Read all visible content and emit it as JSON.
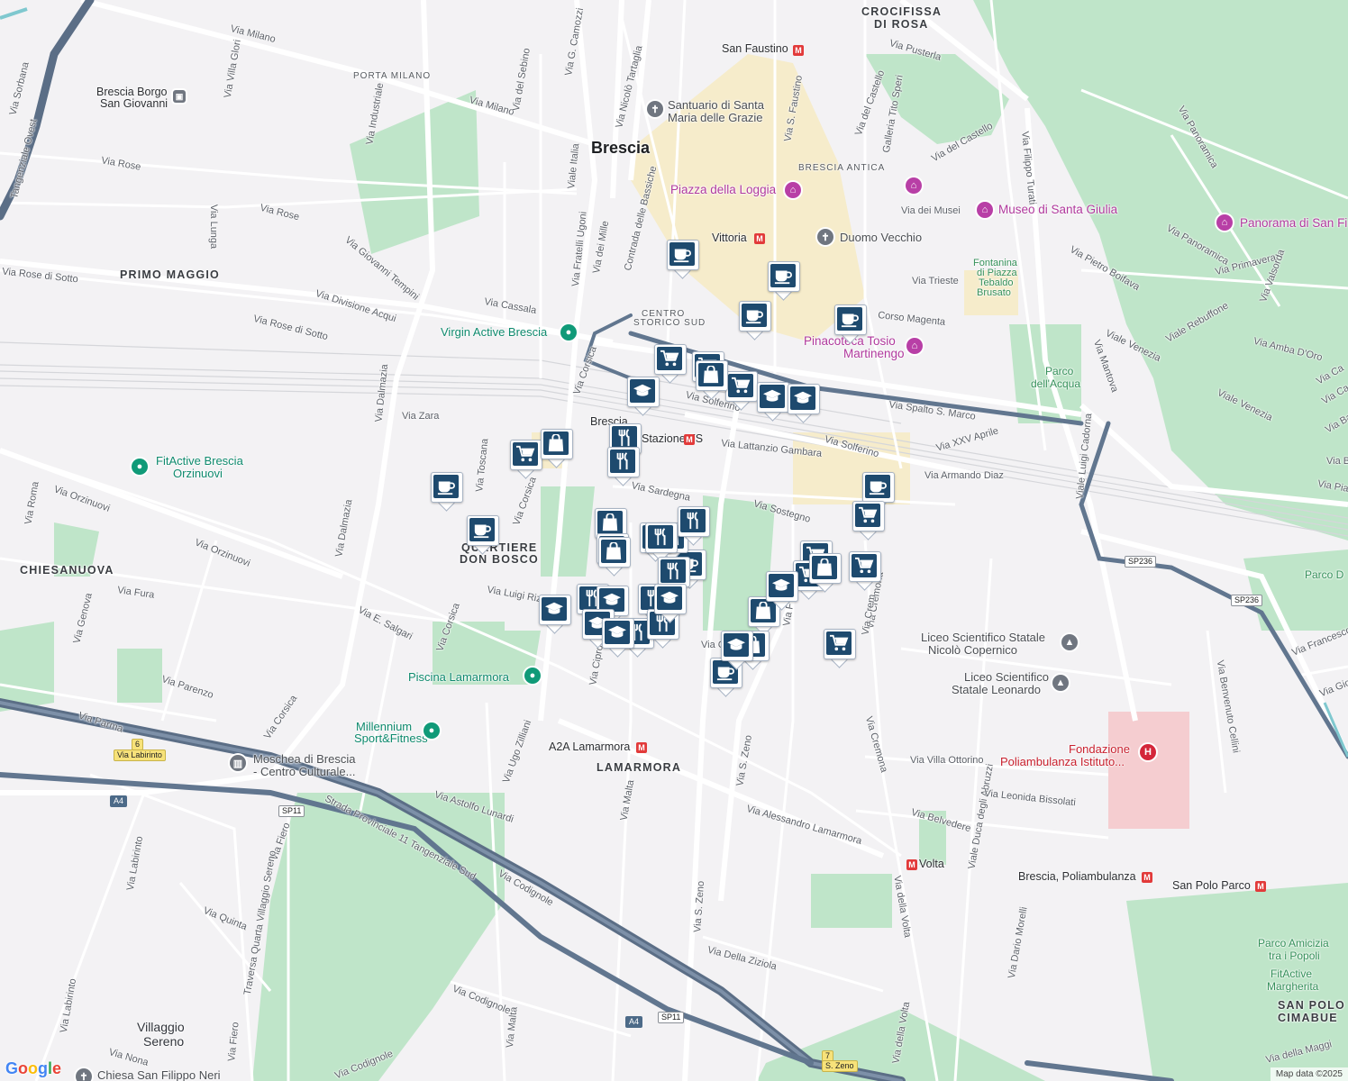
{
  "map": {
    "city": "Brescia",
    "districts": [
      {
        "name": "PRIMO MAGGIO"
      },
      {
        "name": "CHIESANUOVA"
      },
      {
        "name": "QUARTIERE"
      },
      {
        "name": "DON BOSCO"
      },
      {
        "name": "LAMARMORA"
      },
      {
        "name": "CROCIFISSA"
      },
      {
        "name": "DI ROSA"
      },
      {
        "name": "SAN POLO"
      },
      {
        "name": "CIMABUE"
      }
    ],
    "small_districts": [
      {
        "name": "PORTA MILANO"
      },
      {
        "name": "BRESCIA ANTICA"
      },
      {
        "name": "CENTRO"
      },
      {
        "name": "STORICO SUD"
      }
    ],
    "streets": [
      "Via Milano",
      "Via Milano",
      "Via Rose",
      "Via Rose",
      "Via Rose di Sotto",
      "Via Rose di Sotto",
      "Via Divisione Acqui",
      "Via Giovanni Tempini",
      "Via Cassala",
      "Via Lunga",
      "Via Industriale",
      "Via Villa Glori",
      "Via del Sebino",
      "Via G. Camozzi",
      "Via Nicolò Tartaglia",
      "Viale Italia",
      "Via Fratelli Ugoni",
      "Via dei Mille",
      "Contrada delle Bassiche",
      "Via Sorbana",
      "Tangenziale Ovest",
      "Via Dalmazia",
      "Via Dalmazia",
      "Via Zara",
      "Via Orzinuovi",
      "Via Orzinuovi",
      "Via Roma",
      "Via Genova",
      "Via Fura",
      "Via Toscana",
      "Via Corsica",
      "Via Corsica",
      "Via Corsica",
      "Via Corsica",
      "Via E. Salgari",
      "Via Parenzo",
      "Via Parma",
      "Via Luigi Rizzo",
      "Via Cipro",
      "Via Sardegna",
      "Via Solferino",
      "Via Solferino",
      "Via Lattanzio Gambara",
      "Via Sostegno",
      "Via Spalto S. Marco",
      "Via XXV Aprile",
      "Via Armando Diaz",
      "Via Cremona",
      "Via Cremona",
      "Via S. Zeno",
      "Via S. Zeno",
      "Via Malta",
      "Via Malta",
      "Via Ugo Zilliani",
      "Via Astolfo Lunardi",
      "Via Alessandro Lamarmora",
      "Via della Volta",
      "Via della Volta",
      "Via Codignole",
      "Via Codignole",
      "Via Codignole",
      "Via Della Ziziola",
      "Viale Duca degli Abruzzi",
      "Via Dario Morelli",
      "Via Villa Ottorino",
      "Via Leonida Bissolati",
      "Via Belvedere",
      "Via Labirinto",
      "Via Labirinto",
      "Via Fiero",
      "Via Fiero",
      "Via Quinta",
      "Traversa Quarta Villaggio Sereno",
      "Via Nona",
      "Strada Provinciale 11 Tangenziale Sud",
      "Via Pusterla",
      "Via del Castello",
      "Via del Castello",
      "Galleria Tito Speri",
      "Via S. Faustino",
      "Via dei Musei",
      "Via Trieste",
      "Corso Magenta",
      "Via Filippo Turati",
      "Via Pietro Boifava",
      "Viale Venezia",
      "Viale Venezia",
      "Viale Rebuffone",
      "Via Amba D'Oro",
      "Via Panoramica",
      "Via Panoramica",
      "Via Primavera",
      "Via Valsorda",
      "Viale Luigi Cadorna",
      "Via Mantova",
      "Via Francesco",
      "Via Benvenuto Cellini",
      "Via della Maggi",
      "Via Gio",
      "Via Pia",
      "Via Ba",
      "Via Ca",
      "Via Ba",
      "Via Ca",
      "Via C",
      "Via F",
      "Via Crem"
    ],
    "pois": [
      {
        "name": "Santuario di Santa",
        "kind": "gray"
      },
      {
        "name": "Maria delle Grazie",
        "kind": "gray"
      },
      {
        "name": "Piazza della Loggia",
        "kind": "pink"
      },
      {
        "name": "Museo di Santa Giulia",
        "kind": "pink"
      },
      {
        "name": "Panorama di San Fi",
        "kind": "pink"
      },
      {
        "name": "Duomo Vecchio",
        "kind": "gray"
      },
      {
        "name": "Pinacoteca Tosio",
        "kind": "pink"
      },
      {
        "name": "Martinengo",
        "kind": "pink"
      },
      {
        "name": "Virgin Active Brescia",
        "kind": "teal"
      },
      {
        "name": "FitActive Brescia",
        "kind": "teal"
      },
      {
        "name": "Orzinuovi",
        "kind": "teal"
      },
      {
        "name": "Piscina Lamarmora",
        "kind": "teal"
      },
      {
        "name": "Millennium",
        "kind": "teal"
      },
      {
        "name": "Sport&Fitness",
        "kind": "teal"
      },
      {
        "name": "Moschea di Brescia",
        "kind": "gray"
      },
      {
        "name": "- Centro Culturale...",
        "kind": "gray"
      },
      {
        "name": "Liceo Scientifico Statale",
        "kind": "gray"
      },
      {
        "name": "Nicolò Copernico",
        "kind": "gray"
      },
      {
        "name": "Liceo Scientifico",
        "kind": "gray"
      },
      {
        "name": "Statale Leonardo",
        "kind": "gray"
      },
      {
        "name": "Fondazione",
        "kind": "red"
      },
      {
        "name": "Poliambulanza Istituto...",
        "kind": "red"
      },
      {
        "name": "Fontanina",
        "kind": "green"
      },
      {
        "name": "di Piazza",
        "kind": "green"
      },
      {
        "name": "Tebaldo",
        "kind": "green"
      },
      {
        "name": "Brusato",
        "kind": "green"
      },
      {
        "name": "Parco",
        "kind": "green"
      },
      {
        "name": "dell'Acqua",
        "kind": "green"
      },
      {
        "name": "Parco D",
        "kind": "green"
      },
      {
        "name": "Parco Amicizia",
        "kind": "green"
      },
      {
        "name": "tra i Popoli",
        "kind": "green"
      },
      {
        "name": "FitActive",
        "kind": "green"
      },
      {
        "name": "Margherita",
        "kind": "green"
      },
      {
        "name": "Chiesa San Filippo Neri",
        "kind": "gray"
      },
      {
        "name": "Villaggio",
        "kind": "city"
      },
      {
        "name": "Sereno",
        "kind": "city"
      }
    ],
    "transit": [
      {
        "name": "San Faustino"
      },
      {
        "name": "Vittoria"
      },
      {
        "name": "Brescia Borgo"
      },
      {
        "name": "San Giovanni"
      },
      {
        "name": "Brescia"
      },
      {
        "name": "Stazione FS"
      },
      {
        "name": "A2A Lamarmora"
      },
      {
        "name": "Volta"
      },
      {
        "name": "Brescia, Poliambulanza"
      },
      {
        "name": "San Polo Parco"
      }
    ],
    "road_shields": [
      {
        "text": "A4"
      },
      {
        "text": "A4"
      },
      {
        "text": "SP11"
      },
      {
        "text": "SP11"
      },
      {
        "text": "SP236"
      },
      {
        "text": "SP236"
      },
      {
        "text": "Via Labirinto"
      },
      {
        "text": "6"
      },
      {
        "text": "7"
      },
      {
        "text": "S. Zeno"
      }
    ],
    "attribution": "Map data ©2025",
    "logo": "Google",
    "markers": [
      "coffee",
      "coffee",
      "coffee",
      "coffee",
      "coffee",
      "coffee",
      "coffee",
      "coffee",
      "coffee",
      "cart",
      "cart",
      "cart",
      "cart",
      "cart",
      "cart",
      "cart",
      "cart",
      "cart",
      "bag",
      "bag",
      "bag",
      "bag",
      "bag",
      "bag",
      "bag",
      "bag",
      "bag",
      "fork",
      "fork",
      "fork",
      "fork",
      "fork",
      "fork",
      "fork",
      "fork",
      "fork",
      "fork",
      "cap",
      "cap",
      "cap",
      "cap",
      "cap",
      "cap",
      "cap",
      "cap",
      "cap",
      "cap"
    ]
  }
}
